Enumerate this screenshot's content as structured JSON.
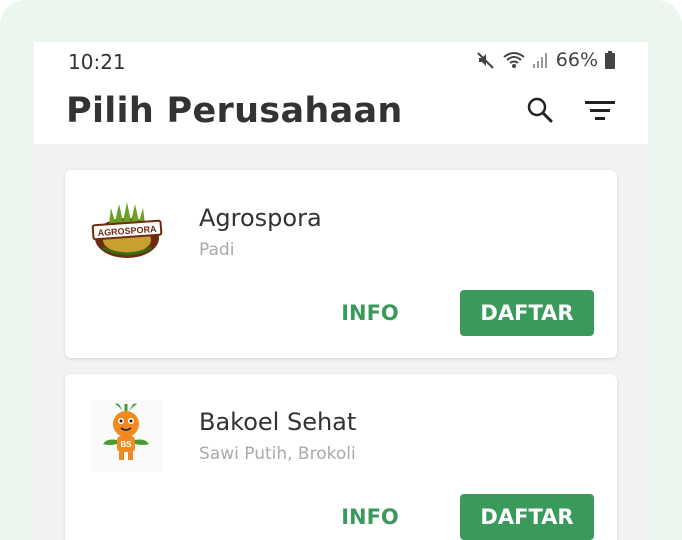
{
  "status_bar": {
    "time": "10:21",
    "battery": "66%",
    "icons": [
      "mute-icon",
      "wifi-icon",
      "signal-icon",
      "battery-icon"
    ]
  },
  "appbar": {
    "title": "Pilih Perusahaan",
    "icons": [
      "search-icon",
      "filter-icon"
    ]
  },
  "companies": [
    {
      "name": "Agrospora",
      "crops": "Padi",
      "logo_text": "AGROSPORA",
      "info_label": "INFO",
      "register_label": "DAFTAR"
    },
    {
      "name": "Bakoel Sehat",
      "crops": "Sawi Putih, Brokoli",
      "logo_text": "BS",
      "info_label": "INFO",
      "register_label": "DAFTAR"
    }
  ],
  "colors": {
    "accent": "#3a9a5c",
    "background": "#f2f2f2",
    "frame": "#eaf6ee"
  }
}
